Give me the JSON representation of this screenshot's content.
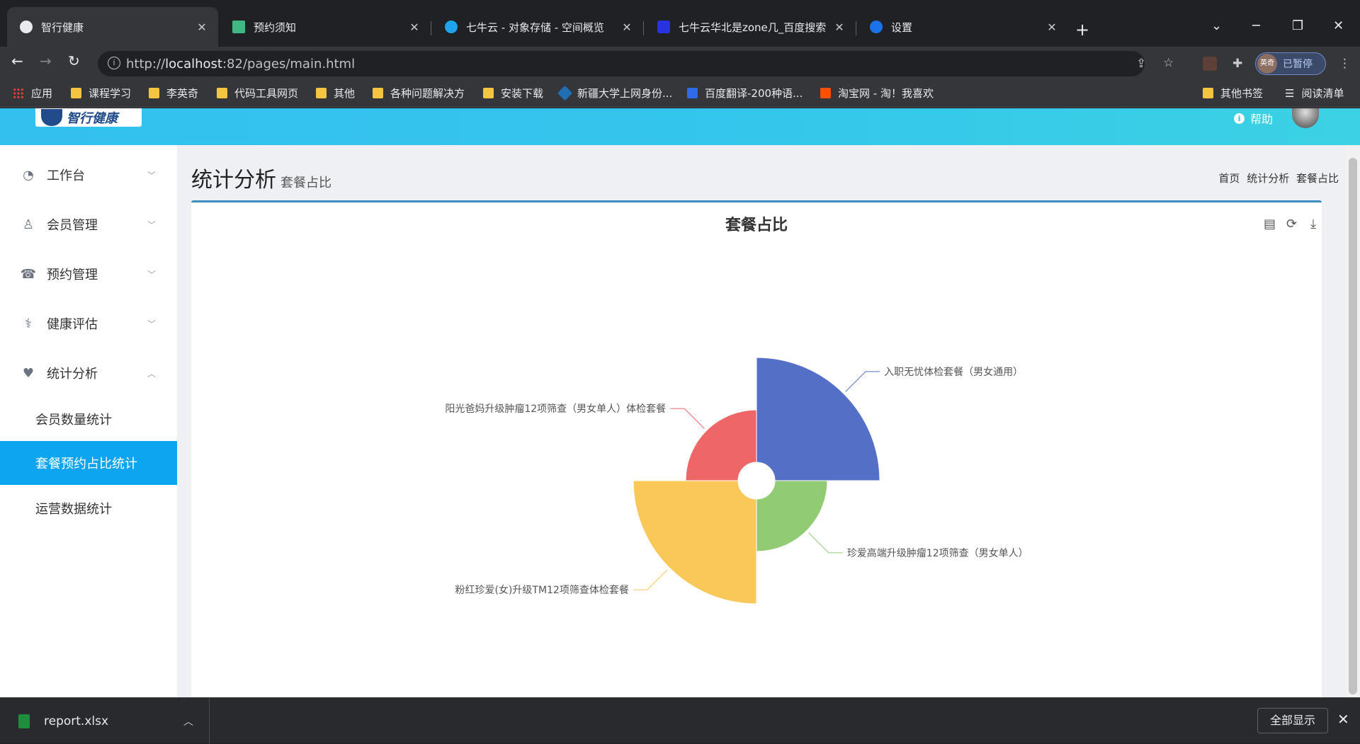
{
  "browser": {
    "tabs": [
      {
        "label": "智行健康",
        "active": true,
        "favicon": "globe-icon",
        "color": "#e8eaed"
      },
      {
        "label": "预约须知",
        "active": false,
        "favicon": "vue-icon",
        "color": "#41b883"
      },
      {
        "label": "七牛云 - 对象存储 - 空间概览",
        "active": false,
        "favicon": "qiniu-icon",
        "color": "#1fa3ed"
      },
      {
        "label": "七牛云华北是zone几_百度搜索",
        "active": false,
        "favicon": "baidu-paw-icon",
        "color": "#2932e1"
      },
      {
        "label": "设置",
        "active": false,
        "favicon": "gear-icon",
        "color": "#1a73e8"
      }
    ],
    "url_prefix": "http://",
    "url_host": "localhost",
    "url_rest": ":82/pages/main.html",
    "profile_label": "已暂停",
    "profile_avatar_text": "英奇",
    "bookmarks": [
      {
        "label": "应用",
        "icon": "apps-grid-icon"
      },
      {
        "label": "课程学习",
        "icon": "folder-icon"
      },
      {
        "label": "李英奇",
        "icon": "folder-icon"
      },
      {
        "label": "代码工具网页",
        "icon": "folder-icon"
      },
      {
        "label": "其他",
        "icon": "folder-icon"
      },
      {
        "label": "各种问题解决方",
        "icon": "folder-icon"
      },
      {
        "label": "安装下载",
        "icon": "folder-icon"
      },
      {
        "label": "新疆大学上网身份...",
        "icon": "network-icon"
      },
      {
        "label": "百度翻译-200种语...",
        "icon": "translate-icon"
      },
      {
        "label": "淘宝网 - 淘！我喜欢",
        "icon": "taobao-icon"
      }
    ],
    "other_bookmarks": "其他书签",
    "reading_list": "阅读清单"
  },
  "header": {
    "logo_text": "智行健康",
    "help_label": "帮助"
  },
  "sidebar": {
    "menus": [
      {
        "label": "工作台",
        "icon": "dashboard-icon",
        "expanded": false
      },
      {
        "label": "会员管理",
        "icon": "user-icon",
        "expanded": false
      },
      {
        "label": "预约管理",
        "icon": "phone-icon",
        "expanded": false
      },
      {
        "label": "健康评估",
        "icon": "stethoscope-icon",
        "expanded": false
      },
      {
        "label": "统计分析",
        "icon": "heartbeat-icon",
        "expanded": true
      }
    ],
    "submenus": [
      {
        "label": "会员数量统计",
        "active": false
      },
      {
        "label": "套餐预约占比统计",
        "active": true
      },
      {
        "label": "运营数据统计",
        "active": false
      }
    ]
  },
  "content": {
    "title": "统计分析",
    "subtitle": "套餐占比",
    "breadcrumb": [
      "首页",
      "统计分析",
      "套餐占比"
    ]
  },
  "chart_data": {
    "type": "pie",
    "variant": "rose",
    "title": "套餐占比",
    "slices": [
      {
        "name": "入职无忧体检套餐（男女通用）",
        "value": 5,
        "color": "#5470c6"
      },
      {
        "name": "珍爱高端升级肿瘤12项筛查（男女单人）",
        "value": 2,
        "color": "#91cc75"
      },
      {
        "name": "粉红珍爱(女)升级TM12项筛查体检套餐",
        "value": 5,
        "color": "#fac858"
      },
      {
        "name": "阳光爸妈升级肿瘤12项筛查（男女单人）体检套餐",
        "value": 2,
        "color": "#ee6666"
      }
    ],
    "toolbox": [
      "data-view-icon",
      "restore-icon",
      "save-image-icon"
    ]
  },
  "download": {
    "filename": "report.xlsx",
    "show_all": "全部显示"
  }
}
